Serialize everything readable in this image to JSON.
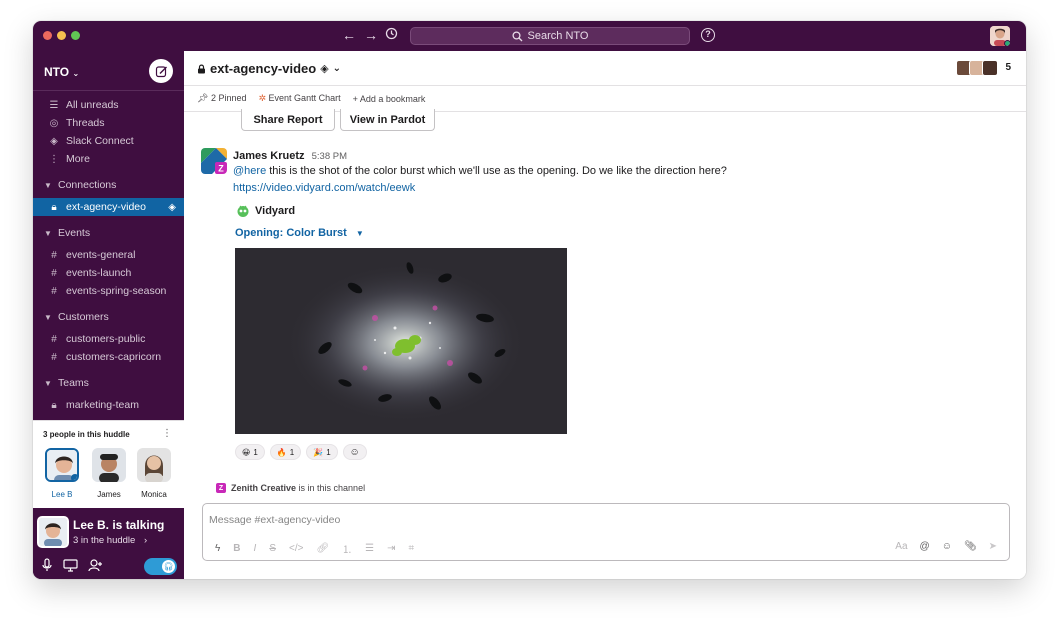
{
  "topbar": {
    "search_label": "Search NTO",
    "help": "?"
  },
  "sidebar": {
    "workspace": "NTO",
    "nav": [
      "All unreads",
      "Threads",
      "Slack Connect",
      "More"
    ],
    "sections": [
      {
        "label": "Connections",
        "channels": [
          "ext-agency-video"
        ]
      },
      {
        "label": "Events",
        "channels": [
          "events-general",
          "events-launch",
          "events-spring-season"
        ]
      },
      {
        "label": "Customers",
        "channels": [
          "customers-public",
          "customers-capricorn"
        ]
      },
      {
        "label": "Teams",
        "channels": [
          "marketing-team"
        ]
      }
    ]
  },
  "huddle": {
    "count_label": "3 people in this huddle",
    "participants": [
      "Lee B",
      "James",
      "Monica"
    ],
    "talking_label": "Lee B. is talking",
    "in_huddle": "3  in the huddle"
  },
  "channel": {
    "name": "ext-agency-video",
    "member_count": "5",
    "bookmarks": [
      "2 Pinned",
      "Event Gantt Chart",
      "Add a bookmark"
    ]
  },
  "buttons": {
    "share_report": "Share Report",
    "view_in_pardot": "View in Pardot"
  },
  "message": {
    "author": "James Kruetz",
    "time": "5:38 PM",
    "mention": "@here",
    "text": " this is the shot of the color burst which we'll use as the opening. Do we like the direction here?",
    "link": "https://video.vidyard.com/watch/eewk",
    "source": "Vidyard",
    "video_title": "Opening: Color Burst",
    "reactions": [
      {
        "emoji": "😀",
        "count": "1"
      },
      {
        "emoji": "🔥",
        "count": "1"
      },
      {
        "emoji": "🎉",
        "count": "1"
      }
    ]
  },
  "joined": {
    "badge": "Z",
    "name": "Zenith Creative",
    "text": " is in this channel"
  },
  "composer": {
    "placeholder": "Message #ext-agency-video"
  },
  "colors": {
    "sidebar": "#3f0e40",
    "active": "#1164a3",
    "link": "#1264a3"
  }
}
